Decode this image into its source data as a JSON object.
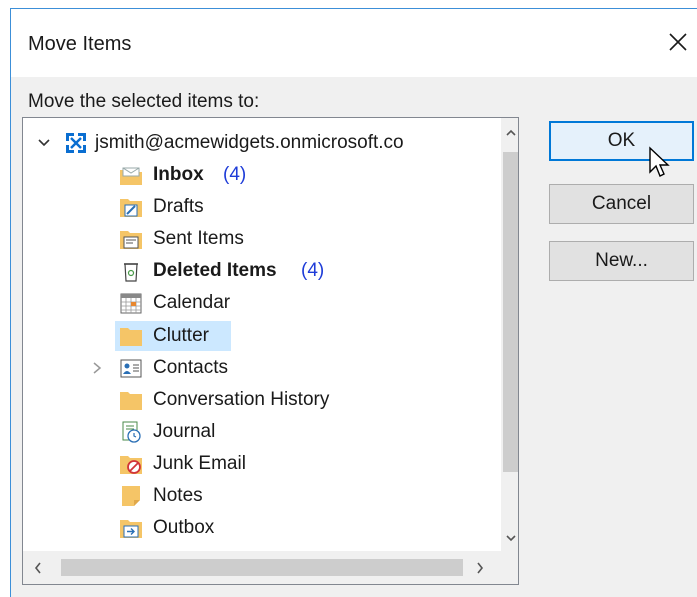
{
  "dialog": {
    "title": "Move Items",
    "prompt": "Move the selected items to:",
    "buttons": {
      "ok": "OK",
      "cancel": "Cancel",
      "new": "New..."
    }
  },
  "tree": {
    "account": "jsmith@acmewidgets.onmicrosoft.co",
    "folders": [
      {
        "label": "Inbox",
        "count": "(4)",
        "bold": true,
        "icon": "inbox-icon"
      },
      {
        "label": "Drafts",
        "count": "",
        "bold": false,
        "icon": "drafts-icon"
      },
      {
        "label": "Sent Items",
        "count": "",
        "bold": false,
        "icon": "sent-items-icon"
      },
      {
        "label": "Deleted Items",
        "count": "(4)",
        "bold": true,
        "icon": "deleted-items-icon"
      },
      {
        "label": "Calendar",
        "count": "",
        "bold": false,
        "icon": "calendar-icon"
      },
      {
        "label": "Clutter",
        "count": "",
        "bold": false,
        "icon": "folder-icon",
        "selected": true
      },
      {
        "label": "Contacts",
        "count": "",
        "bold": false,
        "icon": "contacts-icon",
        "expandable": true
      },
      {
        "label": "Conversation History",
        "count": "",
        "bold": false,
        "icon": "folder-icon"
      },
      {
        "label": "Journal",
        "count": "",
        "bold": false,
        "icon": "journal-icon"
      },
      {
        "label": "Junk Email",
        "count": "",
        "bold": false,
        "icon": "junk-email-icon"
      },
      {
        "label": "Notes",
        "count": "",
        "bold": false,
        "icon": "notes-icon"
      },
      {
        "label": "Outbox",
        "count": "",
        "bold": false,
        "icon": "outbox-icon"
      }
    ]
  },
  "colors": {
    "accent": "#0078d7",
    "selection": "#cce8ff",
    "count": "#1e3cd8",
    "folder": "#f5c567"
  }
}
